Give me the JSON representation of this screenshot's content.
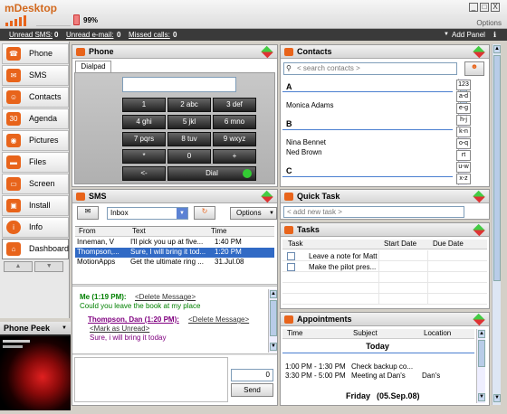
{
  "app": {
    "title": "mDesktop",
    "battery": "99%",
    "options_link": "Options"
  },
  "window_buttons": [
    "_",
    "□",
    "X"
  ],
  "status": {
    "unread_sms_label": "Unread SMS:",
    "unread_sms": "0",
    "unread_email_label": "Unread e-mail:",
    "unread_email": "0",
    "missed_calls_label": "Missed calls:",
    "missed_calls": "0",
    "add_panel": "Add Panel"
  },
  "nav": [
    {
      "label": "Phone",
      "icon": "phone-icon"
    },
    {
      "label": "SMS",
      "icon": "sms-icon"
    },
    {
      "label": "Contacts",
      "icon": "contacts-icon"
    },
    {
      "label": "Agenda",
      "icon": "calendar-icon",
      "icon_text": "30"
    },
    {
      "label": "Pictures",
      "icon": "camera-icon"
    },
    {
      "label": "Files",
      "icon": "folder-icon"
    },
    {
      "label": "Screen",
      "icon": "screen-icon"
    },
    {
      "label": "Install",
      "icon": "install-icon"
    },
    {
      "label": "Info",
      "icon": "info-icon",
      "icon_text": "i"
    },
    {
      "label": "Dashboard",
      "icon": "home-icon"
    }
  ],
  "phone_peek": {
    "title": "Phone Peek"
  },
  "phone": {
    "title": "Phone",
    "tab": "Dialpad",
    "keys": [
      "1",
      "2 abc",
      "3 def",
      "4 ghi",
      "5 jkl",
      "6 mno",
      "7 pqrs",
      "8 tuv",
      "9 wxyz",
      "*",
      "0",
      "+"
    ],
    "backspace": "<-",
    "dial": "Dial"
  },
  "contacts": {
    "title": "Contacts",
    "search_placeholder": "< search contacts >",
    "groups": [
      {
        "letter": "A",
        "names": [
          "Monica Adams"
        ]
      },
      {
        "letter": "B",
        "names": [
          "Nina Bennet",
          "Ned Brown"
        ]
      },
      {
        "letter": "C",
        "names": []
      }
    ],
    "alpha": [
      "123",
      "a-d",
      "e-g",
      "h-j",
      "k-n",
      "o-q",
      "rt",
      "u-w",
      "x-z"
    ]
  },
  "sms": {
    "title": "SMS",
    "folder": "Inbox",
    "options": "Options",
    "columns": [
      "From",
      "Text",
      "Time"
    ],
    "rows": [
      {
        "from": "Inneman, V",
        "text": "I'll pick you up at five...",
        "time": "1:40 PM"
      },
      {
        "from": "Thompson,...",
        "text": "Sure, I will bring it tod...",
        "time": "1:20 PM"
      },
      {
        "from": "MotionApps",
        "text": "Get the ultimate ring ...",
        "time": "31.Jul.08"
      }
    ],
    "conversation": {
      "me_label": "Me (1:19 PM):",
      "delete_1": "<Delete Message>",
      "me_text": "Could you leave the book at my place",
      "other_label": "Thompson, Dan (1:20 PM):",
      "delete_2": "<Delete Message>",
      "mark_unread": "<Mark as Unread>",
      "other_text": "Sure, i will bring it today"
    },
    "char_count": "0",
    "send": "Send"
  },
  "quick_task": {
    "title": "Quick Task",
    "placeholder": "< add new task >"
  },
  "tasks": {
    "title": "Tasks",
    "columns": [
      "Task",
      "Start Date",
      "Due Date"
    ],
    "rows": [
      {
        "task": "Leave a note for Matt",
        "start": "",
        "due": ""
      },
      {
        "task": "Make the pilot pres...",
        "start": "",
        "due": ""
      }
    ]
  },
  "appointments": {
    "title": "Appointments",
    "columns": [
      "Time",
      "Subject",
      "Location"
    ],
    "today_label": "Today",
    "rows": [
      {
        "time": "1:00 PM - 1:30 PM",
        "subject": "Check backup co...",
        "location": ""
      },
      {
        "time": "3:30 PM - 5:00 PM",
        "subject": "Meeting at Dan's",
        "location": "Dan's"
      }
    ],
    "next_day": "Friday",
    "next_date": "(05.Sep.08)"
  },
  "colors": {
    "accent": "#e8641b",
    "selection": "#316ac5",
    "msg_green": "#008000",
    "msg_purple": "#800080"
  }
}
